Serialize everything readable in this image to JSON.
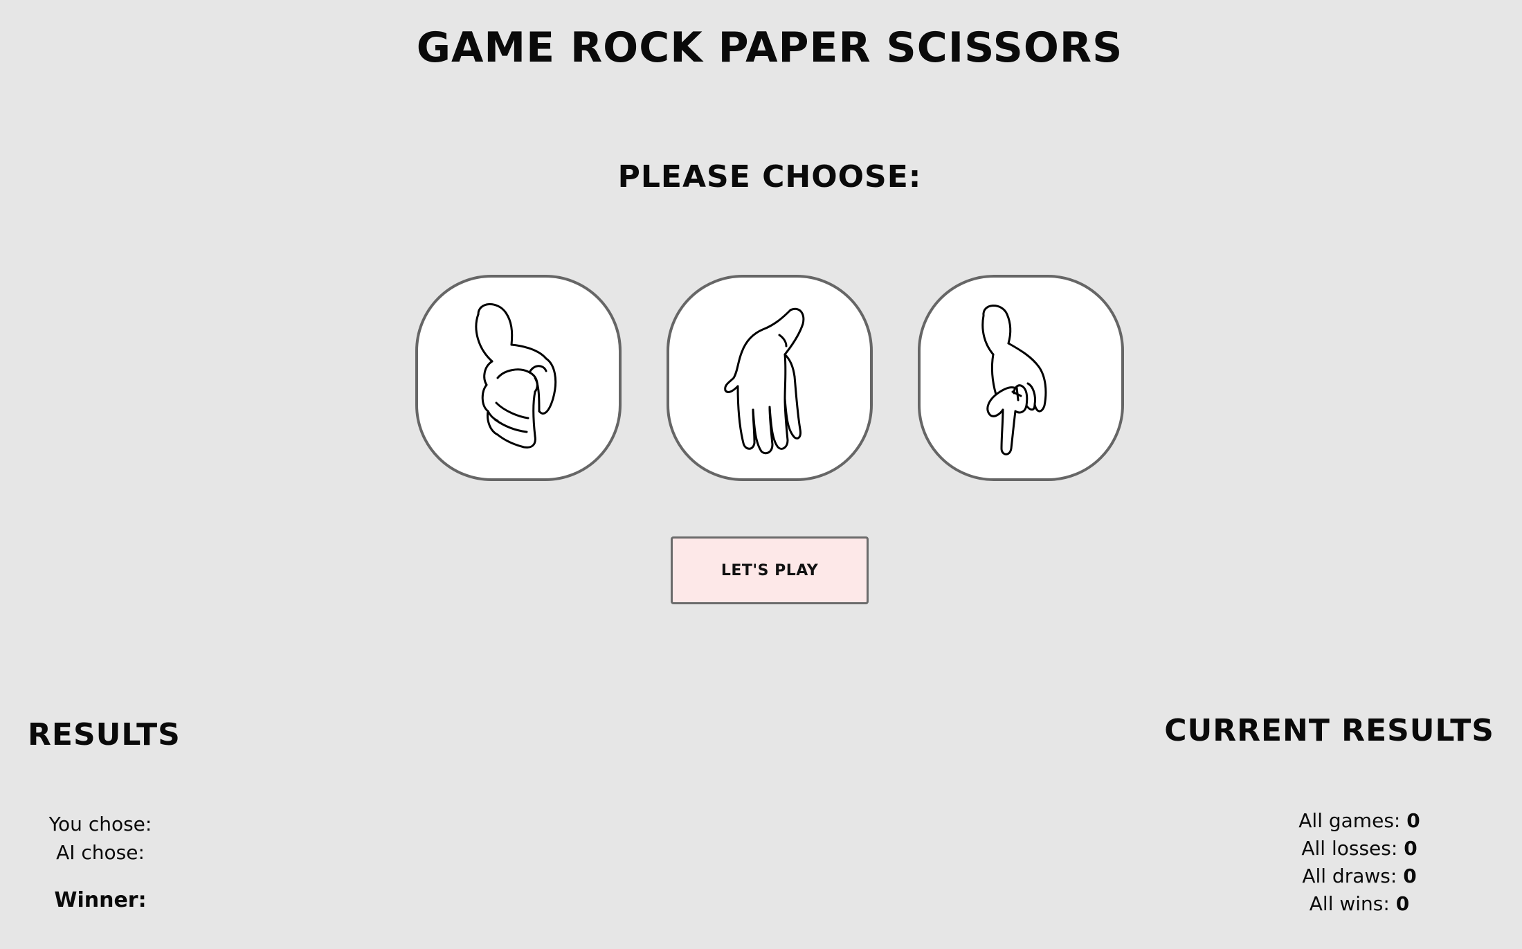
{
  "header": {
    "title": "GAME ROCK PAPER SCISSORS",
    "subtitle": "PLEASE CHOOSE:"
  },
  "choices": [
    {
      "name": "rock",
      "icon": "rock-hand-icon"
    },
    {
      "name": "paper",
      "icon": "paper-hand-icon"
    },
    {
      "name": "scissors",
      "icon": "scissors-hand-icon"
    }
  ],
  "play_button": {
    "label": "LET'S PLAY"
  },
  "results": {
    "title": "RESULTS",
    "you_chose_label": "You chose:",
    "ai_chose_label": "AI chose:",
    "winner_label": "Winner:"
  },
  "current_results": {
    "title": "CURRENT RESULTS",
    "stats": [
      {
        "label": "All games:",
        "value": "0"
      },
      {
        "label": "All losses:",
        "value": "0"
      },
      {
        "label": "All draws:",
        "value": "0"
      },
      {
        "label": "All wins:",
        "value": "0"
      }
    ]
  },
  "colors": {
    "background": "#e6e6e6",
    "card_border": "#666666",
    "button_bg": "#fde8e8"
  }
}
